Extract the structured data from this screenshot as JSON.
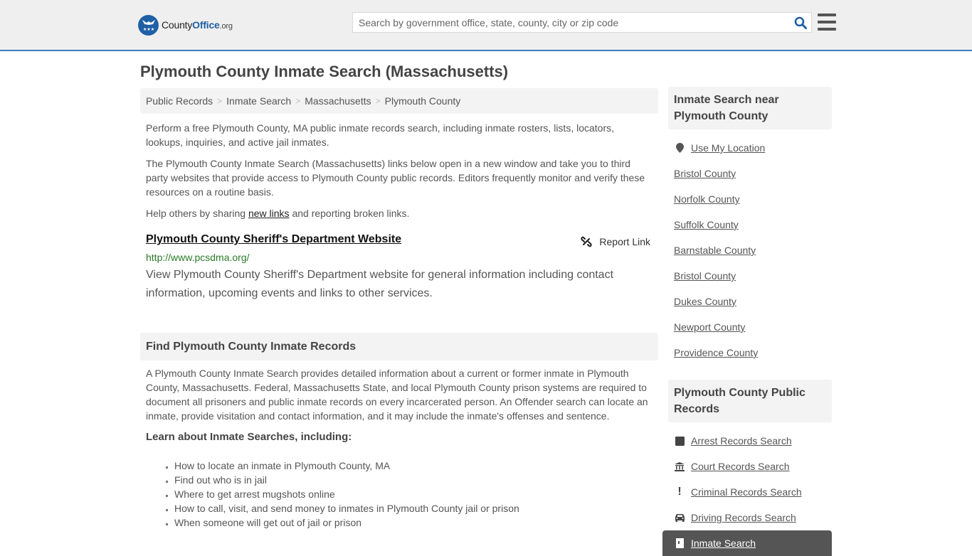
{
  "header": {
    "logo": {
      "name": "CountyOffice",
      "brand_part1": "County",
      "brand_part2": "Office",
      "tld": ".org"
    },
    "search": {
      "placeholder": "Search by government office, state, county, city or zip code",
      "value": ""
    },
    "icons": {
      "search": "search-icon",
      "menu": "hamburger-menu-icon"
    }
  },
  "page": {
    "title": "Plymouth County Inmate Search (Massachusetts)"
  },
  "breadcrumb": [
    {
      "label": "Public Records"
    },
    {
      "label": "Inmate Search"
    },
    {
      "label": "Massachusetts"
    },
    {
      "label": "Plymouth County"
    }
  ],
  "intro": {
    "p1": "Perform a free Plymouth County, MA public inmate records search, including inmate rosters, lists, locators, lookups, inquiries, and active jail inmates.",
    "p2": "The Plymouth County Inmate Search (Massachusetts) links below open in a new window and take you to third party websites that provide access to Plymouth County public records. Editors frequently monitor and verify these resources on a routine basis.",
    "p3_before": "Help others by sharing ",
    "p3_link": "new links",
    "p3_after": " and reporting broken links."
  },
  "resource": {
    "title": "Plymouth County Sheriff's Department Website",
    "url": "http://www.pcsdma.org/",
    "description": "View Plymouth County Sheriff's Department website for general information including contact information, upcoming events and links to other services.",
    "report_label": "Report Link"
  },
  "records_section": {
    "heading": "Find Plymouth County Inmate Records",
    "body": "A Plymouth County Inmate Search provides detailed information about a current or former inmate in Plymouth County, Massachusetts. Federal, Massachusetts State, and local Plymouth County prison systems are required to document all prisoners and public inmate records on every incarcerated person. An Offender search can locate an inmate, provide visitation and contact information, and it may include the inmate's offenses and sentence.",
    "learn_heading": "Learn about Inmate Searches, including:",
    "bullets": [
      "How to locate an inmate in Plymouth County, MA",
      "Find out who is in jail",
      "Where to get arrest mugshots online",
      "How to call, visit, and send money to inmates in Plymouth County jail or prison",
      "When someone will get out of jail or prison"
    ]
  },
  "sidebar": {
    "nearby": {
      "heading": "Inmate Search near Plymouth County",
      "use_location": "Use My Location",
      "items": [
        "Bristol County",
        "Norfolk County",
        "Suffolk County",
        "Barnstable County",
        "Bristol County",
        "Dukes County",
        "Newport County",
        "Providence County"
      ]
    },
    "public_records": {
      "heading": "Plymouth County Public Records",
      "items": [
        {
          "label": "Arrest Records Search",
          "icon": "arrest-square-icon"
        },
        {
          "label": "Court Records Search",
          "icon": "courthouse-icon"
        },
        {
          "label": "Criminal Records Search",
          "icon": "exclamation-icon"
        },
        {
          "label": "Driving Records Search",
          "icon": "car-icon"
        }
      ],
      "active": {
        "label": "Inmate Search",
        "icon": "jail-door-icon"
      }
    }
  }
}
